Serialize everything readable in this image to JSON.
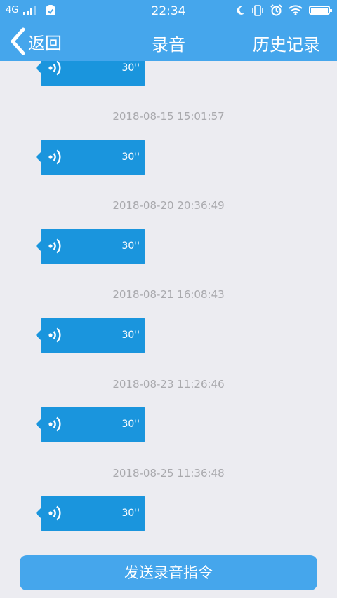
{
  "status_bar": {
    "network": "4G",
    "time": "22:34"
  },
  "nav": {
    "back_label": "返回",
    "title": "录音",
    "history_label": "历史记录"
  },
  "recordings": [
    {
      "timestamp": "",
      "duration": "30''"
    },
    {
      "timestamp": "2018-08-15 15:01:57",
      "duration": "30''"
    },
    {
      "timestamp": "2018-08-20 20:36:49",
      "duration": "30''"
    },
    {
      "timestamp": "2018-08-21 16:08:43",
      "duration": "30''"
    },
    {
      "timestamp": "2018-08-23 11:26:46",
      "duration": "30''"
    },
    {
      "timestamp": "2018-08-25 11:36:48",
      "duration": "30''"
    }
  ],
  "send_button_label": "发送录音指令",
  "colors": {
    "accent": "#45a6ec",
    "bubble": "#1a95dd",
    "background": "#ececf1",
    "timestamp_text": "#a9a9ad"
  }
}
